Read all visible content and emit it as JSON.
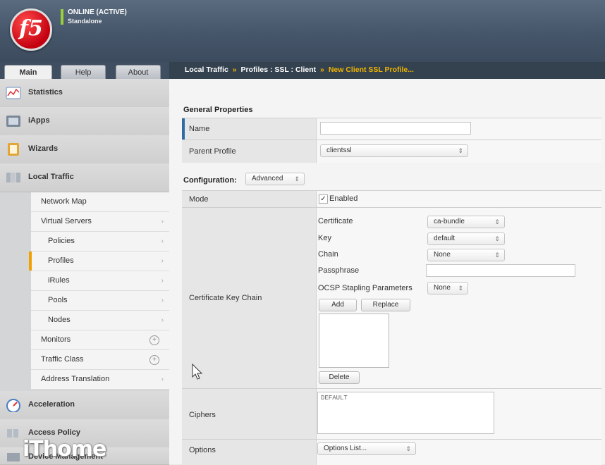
{
  "header": {
    "logo_text": "f5",
    "status": "ONLINE (ACTIVE)",
    "mode": "Standalone"
  },
  "tabs": [
    {
      "label": "Main"
    },
    {
      "label": "Help"
    },
    {
      "label": "About"
    }
  ],
  "breadcrumb": {
    "part1": "Local Traffic",
    "sep1": "»",
    "part2": "Profiles : SSL : Client",
    "sep2": "»",
    "current": "New Client SSL Profile..."
  },
  "sidebar": {
    "top_items": [
      {
        "label": "Statistics"
      },
      {
        "label": "iApps"
      },
      {
        "label": "Wizards"
      },
      {
        "label": "Local Traffic"
      }
    ],
    "sub_items": [
      {
        "label": "Network Map"
      },
      {
        "label": "Virtual Servers"
      },
      {
        "label": "Policies"
      },
      {
        "label": "Profiles"
      },
      {
        "label": "iRules"
      },
      {
        "label": "Pools"
      },
      {
        "label": "Nodes"
      },
      {
        "label": "Monitors"
      },
      {
        "label": "Traffic Class"
      },
      {
        "label": "Address Translation"
      }
    ],
    "bottom_items": [
      {
        "label": "Acceleration"
      },
      {
        "label": "Access Policy"
      },
      {
        "label": "Device Management"
      }
    ]
  },
  "watermark": "iThome",
  "general": {
    "title": "General Properties",
    "name_label": "Name",
    "name_value": "",
    "parent_label": "Parent Profile",
    "parent_value": "clientssl"
  },
  "config": {
    "title": "Configuration:",
    "level": "Advanced",
    "mode_label": "Mode",
    "mode_value": "Enabled",
    "ckc_label": "Certificate Key Chain",
    "certificate_label": "Certificate",
    "certificate_value": "ca-bundle",
    "key_label": "Key",
    "key_value": "default",
    "chain_label": "Chain",
    "chain_value": "None",
    "passphrase_label": "Passphrase",
    "ocsp_label": "OCSP Stapling Parameters",
    "ocsp_value": "None",
    "add_label": "Add",
    "replace_label": "Replace",
    "delete_label": "Delete",
    "ciphers_label": "Ciphers",
    "ciphers_value": "DEFAULT",
    "options_label": "Options",
    "options_value": "Options List..."
  },
  "colors": {
    "accent": "#f0b400",
    "header": "#46566a",
    "online": "#9bcf3a"
  }
}
